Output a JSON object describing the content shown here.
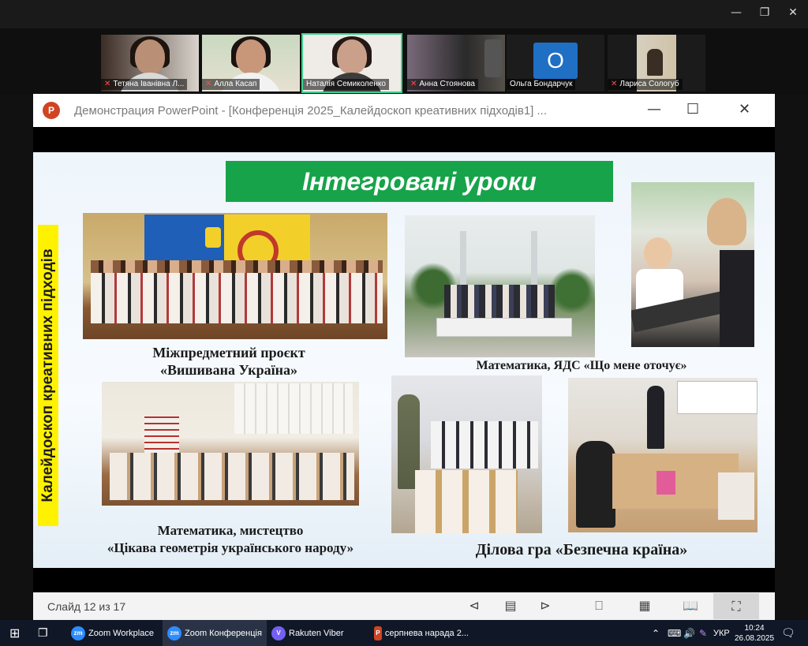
{
  "window": {
    "minimize": "—",
    "maximize": "❐",
    "close": "✕"
  },
  "participants": [
    {
      "name": "Тетяна Іванівна Л...",
      "muted": true
    },
    {
      "name": "Алла Касап",
      "muted": true
    },
    {
      "name": "Наталія Семиколенко",
      "muted": false
    },
    {
      "name": "Анна Стоянова",
      "muted": true
    },
    {
      "name": "Ольга Бондарчук",
      "muted": false,
      "initial": "О"
    },
    {
      "name": "Лариса Сологуб",
      "muted": true
    }
  ],
  "ppt": {
    "title": "Демонстрация PowerPoint - [Конференція 2025_Калейдоскоп креативних підходів1] ...",
    "logo": "P",
    "minimize": "—",
    "maximize": "☐",
    "close": "✕"
  },
  "slide": {
    "title": "Інтегровані уроки",
    "side_label": "Калейдоскоп креативних підходів",
    "captions": {
      "c1a": "Міжпредметний проєкт",
      "c1b": "«Вишивана Україна»",
      "c2": "Математика, ЯДС «Що мене оточує»",
      "c3a": "Математика, мистецтво",
      "c3b": "«Цікава геометрія українського народу»",
      "c4": "Ділова гра «Безпечна країна»"
    }
  },
  "status": {
    "slide_counter": "Слайд 12 из 17"
  },
  "taskbar": {
    "apps": [
      {
        "label": "Zoom Workplace",
        "icon": "zm"
      },
      {
        "label": "Zoom Конференція",
        "icon": "zm"
      },
      {
        "label": "Rakuten Viber",
        "icon": "V"
      },
      {
        "label": "серпнева нарада 2...",
        "icon": "P"
      }
    ],
    "lang": "УКР",
    "time": "10:24",
    "date": "26.08.2025"
  },
  "colors": {
    "banner": "#17a34a",
    "side_label_bg": "#fff200",
    "ppt_brand": "#d04423",
    "zoom_blue": "#2d8cff",
    "active_speaker": "#3bd38b"
  }
}
